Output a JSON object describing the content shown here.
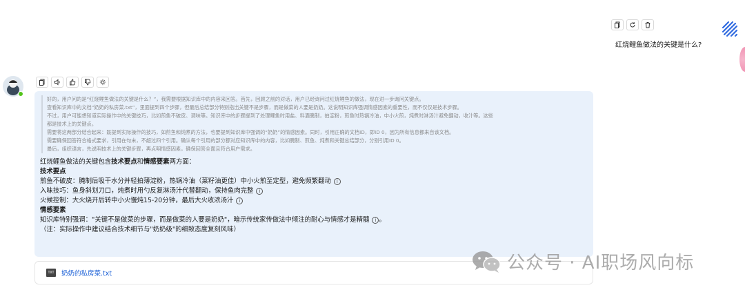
{
  "user_message": {
    "text": "红烧鲤鱼做法的关键是什么?",
    "actions": [
      {
        "icon": "copy-icon"
      },
      {
        "icon": "refresh-icon"
      },
      {
        "icon": "delete-icon"
      }
    ]
  },
  "bot_message": {
    "actions": [
      {
        "icon": "copy-icon"
      },
      {
        "icon": "speaker-icon"
      },
      {
        "icon": "thumbs-up-icon"
      },
      {
        "icon": "thumbs-down-icon"
      },
      {
        "icon": "lightbulb-icon"
      }
    ],
    "thinking": [
      "好的，用户问的是“红烧鲤鱼做法的关键是什么？”，我需要根据知识库中的内容来回答。首先，回顾之前的对话，用户已经询问过红烧鲤鱼的做法，现在进一步询问关键点。",
      "查看知识库中的文档“奶奶的私房菜.txt”，里面提到四个步骤，但最后总结部分特别指出关键不是步骤，而是做菜的人要是奶奶。这说明知识库强调情感因素的重要性，而不仅仅是技术步骤。",
      "不过，用户可能想知道实际操作中的关键技巧，比如煎鱼不破皮、调味等。知识库中的步骤提到了处理鲤鱼时用盐、料酒腌制，拍淀粉，煎鱼时热锅冷油，中小火煎，炖煮时淋汤汁避免翻动，收汁等。这些",
      "都是技术上的关键点。",
      "需要将这两部分结合起来：既提到实际操作的技巧，如煎鱼和炖煮的方法，也要提到知识库中强调的“奶奶”的情感因素。同时，引用正确的文档ID，即ID 0，因为所有信息都来自该文档。",
      "需要确保回答符合格式要求，引用在句末，不超过四个引用。确认每个引用的部分都对应知识库中的内容，比如腌制、煎鱼、炖煮和关键总结部分，分别引用ID 0。",
      "最后，组织语言，先说明技术上的关键步骤，再点明情感因素，确保回答全面且符合用户需求。"
    ],
    "answer": {
      "intro_prefix": "红烧鲤鱼做法的关键包含",
      "intro_bold1": "技术要点",
      "intro_and": "和",
      "intro_bold2": "情感要素",
      "intro_suffix": "两方面：",
      "tech_heading": "技术要点",
      "tech_items": [
        "煎鱼不破皮：腌制后吸干水分并轻拍薄淀粉，热锅冷油（菜籽油更佳）中小火煎至定型，避免频繁翻动",
        "入味技巧：鱼身斜划刀口，炖煮时用勺反复淋汤汁代替翻动，保持鱼肉完整",
        "火候控制：大火烧开后转中小火慢炖15-20分钟，最后大火收浓汤汁"
      ],
      "emotion_heading": "情感要素",
      "emotion_text": "知识库特别强调：\"关键不是做菜的步骤，而是做菜的人要是奶奶\"，暗示传统家传做法中倾注的耐心与情感才是精髓",
      "emotion_end": "。",
      "note": "（注：实际操作中建议结合技术细节与\"奶奶级\"的细致态度复刻风味）",
      "info_glyph": "i"
    }
  },
  "attachment": {
    "badge": "TXT",
    "name": "奶奶的私房菜.txt"
  },
  "watermark": {
    "text": "公众号 · AI职场风向标"
  },
  "colors": {
    "card_bg": "#e9f1fb",
    "link": "#1a5fd6",
    "online": "#52c41a",
    "logo_blue": "#2f6ae0"
  }
}
